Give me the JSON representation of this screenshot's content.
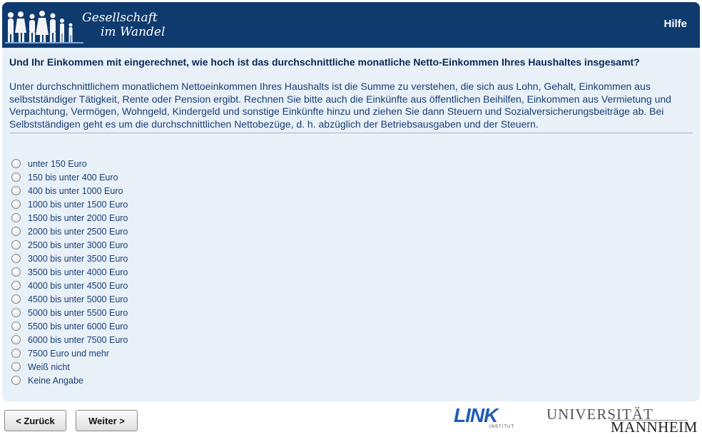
{
  "header": {
    "logo_line1": "Gesellschaft",
    "logo_line2": "im Wandel",
    "help_label": "Hilfe",
    "color": "#0f3a6e"
  },
  "question": {
    "title": "Und Ihr Einkommen mit eingerechnet, wie hoch ist das durchschnittliche monatliche Netto-Einkommen Ihres Haushaltes insgesamt?",
    "description": "Unter durchschnittlichem monatlichem Nettoeinkommen Ihres Haushalts ist die Summe zu verstehen, die sich aus Lohn, Gehalt, Einkommen aus selbstständiger Tätigkeit, Rente oder Pension ergibt. Rechnen Sie bitte auch die Einkünfte aus öffentlichen Beihilfen, Einkommen aus Vermietung und Verpachtung, Vermögen, Wohngeld, Kindergeld und sonstige Einkünfte hinzu und ziehen Sie dann Steuern und Sozialversicherungsbeiträge ab. Bei Selbstständigen geht es um die durchschnittlichen Nettobezüge, d. h. abzüglich der Betriebsausgaben und der Steuern."
  },
  "options": [
    "unter 150 Euro",
    "150 bis unter 400 Euro",
    "400 bis unter 1000 Euro",
    "1000 bis unter 1500 Euro",
    "1500 bis unter 2000 Euro",
    "2000 bis unter 2500 Euro",
    "2500 bis unter 3000 Euro",
    "3000 bis unter 3500 Euro",
    "3500 bis unter 4000 Euro",
    "4000 bis unter 4500 Euro",
    "4500 bis unter 5000 Euro",
    "5000 bis unter 5500 Euro",
    "5500 bis unter 6000 Euro",
    "6000 bis unter 7500 Euro",
    "7500 Euro und mehr",
    "Weiß nicht",
    "Keine Angabe"
  ],
  "nav": {
    "back_label": "< Zurück",
    "next_label": "Weiter >"
  },
  "footer": {
    "link_logo": "LINK",
    "link_sub": "INSTITUT",
    "uni_line1": "UNIVERSITÄT",
    "uni_line2": "MANNHEIM"
  }
}
